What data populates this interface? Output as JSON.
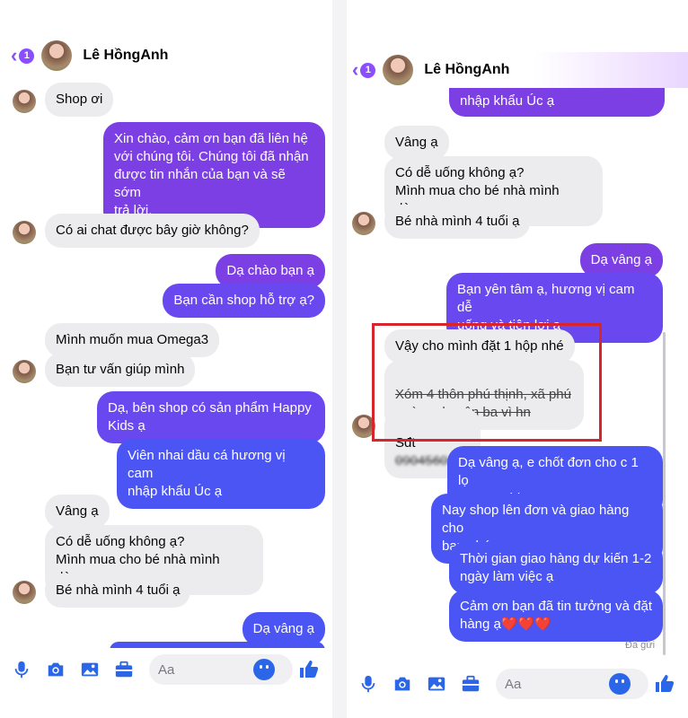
{
  "contact_name": "Lê HồngAnh",
  "back_badge": "1",
  "input_placeholder": "Aa",
  "seen_label": "Đã gửi",
  "colors": {
    "accent": "#8a4dff",
    "outgoing_purple": "#7b3fe4",
    "outgoing_blue": "#4a55f4",
    "incoming": "#ececef",
    "highlight_box": "#d7262b"
  },
  "toolbar_icons": [
    "microphone-icon",
    "camera-icon",
    "image-icon",
    "briefcase-icon",
    "emoji-icon",
    "thumbs-up-icon"
  ],
  "left_messages": [
    "Shop ơi",
    "Xin chào, cảm ơn bạn đã liên hệ\nvới chúng tôi. Chúng tôi đã nhận\nđược tin nhắn của bạn và sẽ sớm\ntrả lời.",
    "Có ai chat được bây giờ không?",
    "Dạ chào bạn ạ",
    "Bạn cần shop hỗ trợ ạ?",
    "Mình muốn mua Omega3",
    "Bạn tư vấn giúp mình",
    "Dạ, bên shop có sản phẩm Happy\nKids ạ",
    "Viên nhai dầu cá hương vị cam\nnhập khẩu Úc ạ",
    "Vâng ạ",
    "Có dễ uống không ạ?\nMình mua cho bé nhà mình dùng",
    "Bé nhà mình 4 tuổi ạ",
    "Dạ vâng ạ"
  ],
  "right_messages": [
    "nhập khẩu Úc ạ",
    "Vâng ạ",
    "Có dễ uống không ạ?\nMình mua cho bé nhà mình dùng",
    "Bé nhà mình 4 tuổi ạ",
    "Dạ vâng ạ",
    "Bạn yên tâm ạ, hương vị cam dễ\nuống và tiện lợi ạ",
    "Vậy cho mình đặt 1 hộp nhé",
    "Xóm 4 thôn phú thịnh, xã phú\ncường, huyện ba vì hn",
    "Sđt",
    "0904560101",
    "Dạ vâng ạ, e chốt đơn cho c 1 lọ\nHappy Kids ạ",
    "Nay shop lên đơn và giao hàng cho\nbạn nhé",
    "Thời gian giao hàng dự kiến 1-2\nngày làm việc ạ",
    "Cảm ơn bạn đã tin tưởng và đặt\nhàng ạ❤️❤️❤️"
  ]
}
